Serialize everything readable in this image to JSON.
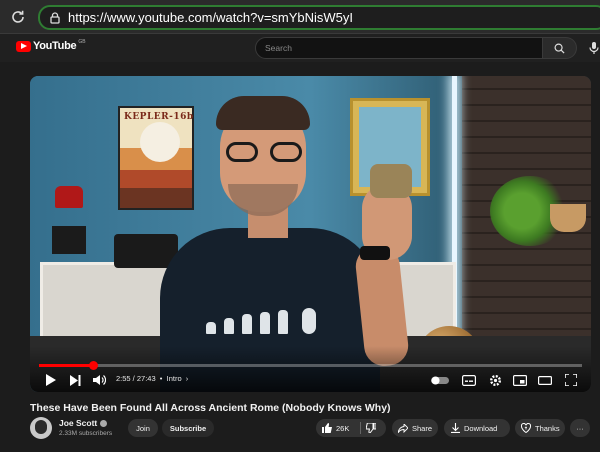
{
  "browser": {
    "url": "https://www.youtube.com/watch?v=smYbNisW5yI",
    "icons": {
      "reload": "reload-icon",
      "lock": "lock-icon"
    }
  },
  "header": {
    "logo_text": "YouTube",
    "country_code": "GB",
    "search_placeholder": "Search",
    "icons": {
      "search": "search-icon",
      "mic": "mic-icon"
    }
  },
  "video": {
    "progress": 0.1,
    "current_time": "2:55",
    "duration": "27:43",
    "time_display": "2:55 / 27:43",
    "chapter": "Intro",
    "poster_text": "KEPLER-16b",
    "colors": {
      "progress": "#ff0000",
      "accent": "#ff0000"
    }
  },
  "info": {
    "title": "These Have Been Found All Across Ancient Rome (Nobody Knows Why)",
    "channel_name": "Joe Scott",
    "subscribers": "2.33M subscribers",
    "join_label": "Join",
    "subscribe_label": "Subscribe",
    "like_count": "26K",
    "share_label": "Share",
    "download_label": "Download",
    "thanks_label": "Thanks"
  }
}
